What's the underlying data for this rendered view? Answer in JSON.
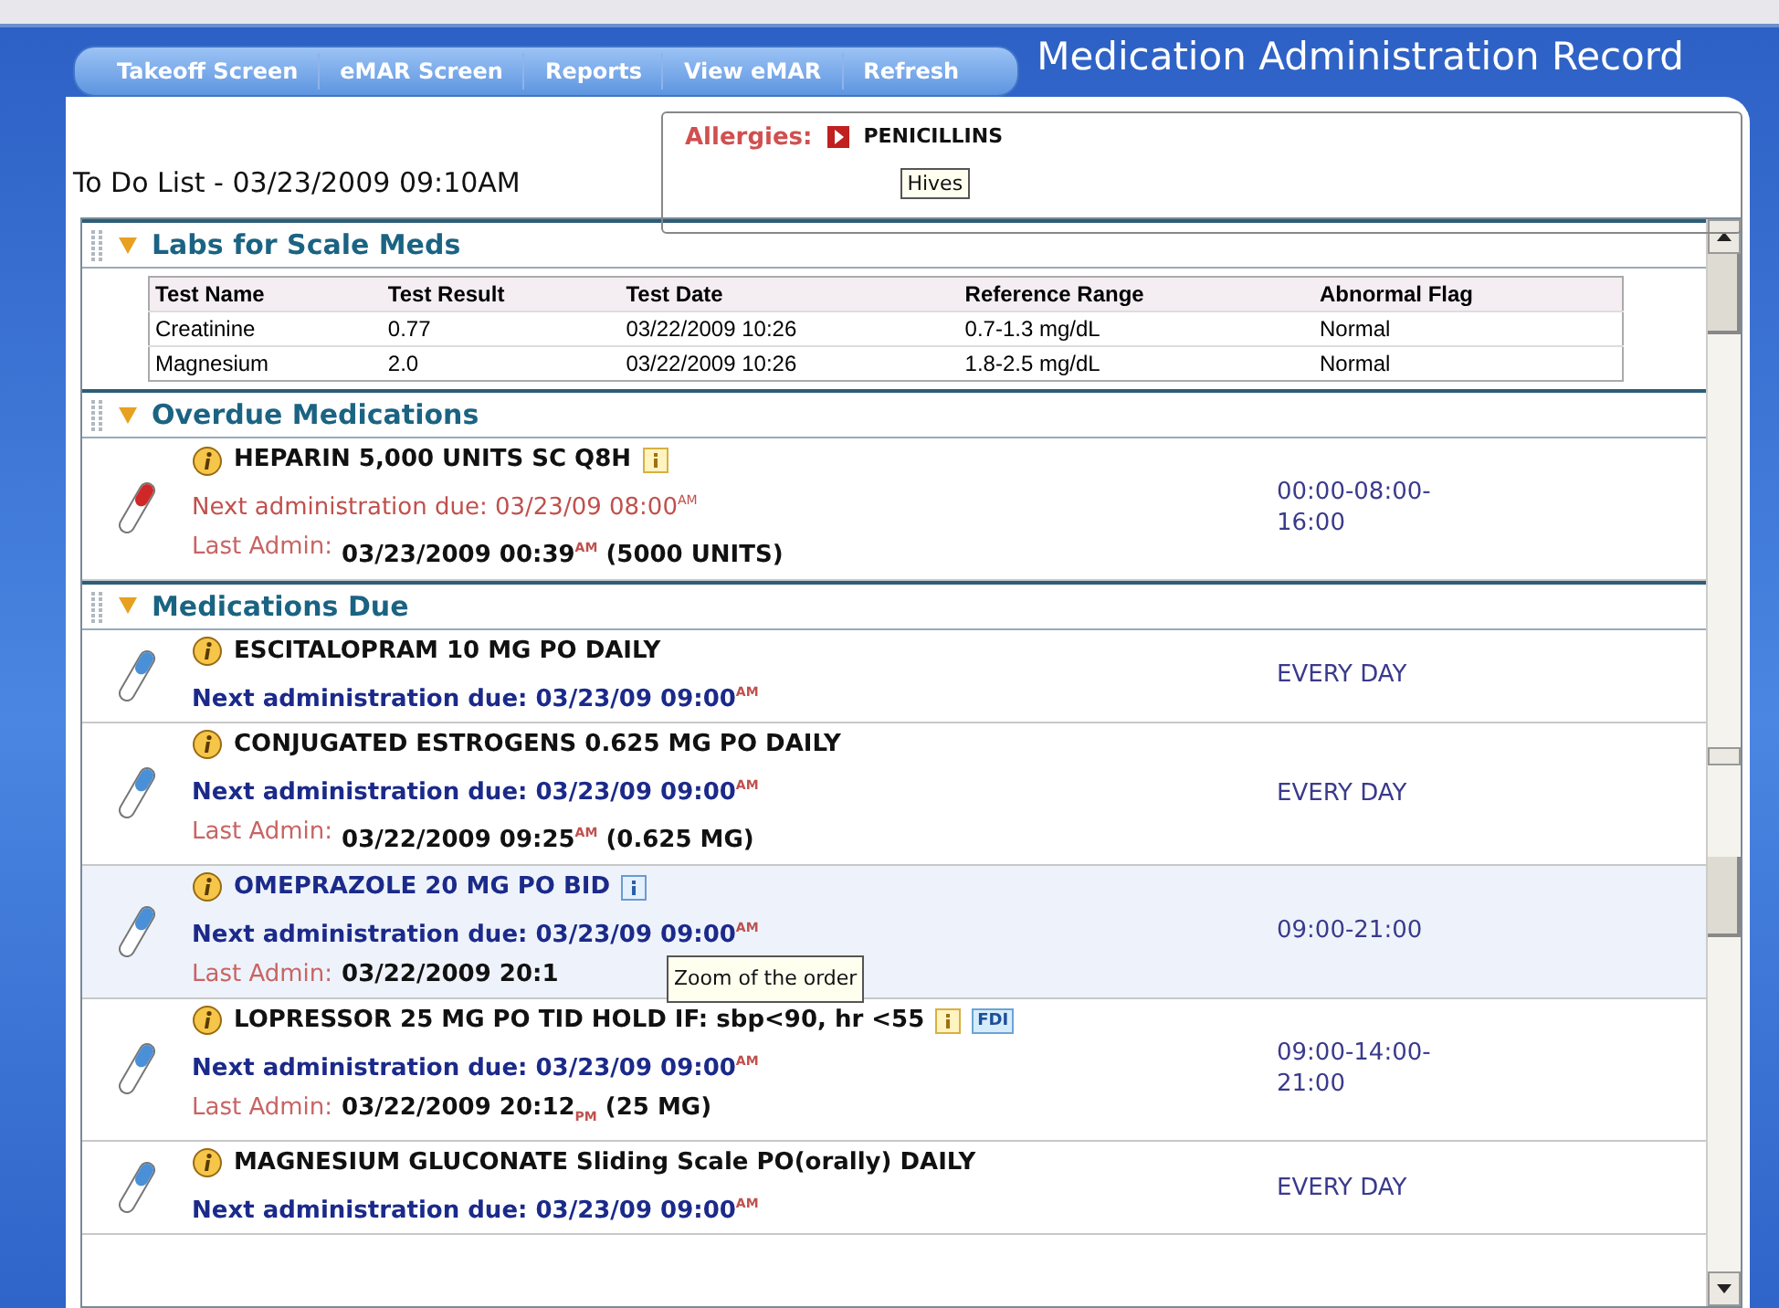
{
  "header": {
    "title": "Medication Administration Record",
    "tabs": [
      {
        "label": "Takeoff Screen"
      },
      {
        "label": "eMAR Screen"
      },
      {
        "label": "Reports"
      },
      {
        "label": "View eMAR"
      },
      {
        "label": "Refresh"
      }
    ]
  },
  "todo_title": "To Do List - 03/23/2009 09:10AM",
  "allergies": {
    "label": "Allergies:",
    "items": [
      {
        "name": "PENICILLINS",
        "tooltip": "Hives"
      }
    ]
  },
  "sections": [
    {
      "kind": "labs",
      "title": "Labs for Scale Meds",
      "expanded": true,
      "table": {
        "columns": [
          "Test Name",
          "Test Result",
          "Test Date",
          "Reference Range",
          "Abnormal Flag"
        ],
        "rows": [
          [
            "Creatinine",
            "0.77",
            "03/22/2009 10:26",
            "0.7-1.3 mg/dL",
            "Normal"
          ],
          [
            "Magnesium",
            "2.0",
            "03/22/2009 10:26",
            "1.8-2.5 mg/dL",
            "Normal"
          ]
        ]
      }
    },
    {
      "kind": "meds",
      "title": "Overdue Medications",
      "expanded": true,
      "items": [
        {
          "name": "HEPARIN 5,000 UNITS SC Q8H",
          "overdue": true,
          "highlighted": false,
          "badges": [
            {
              "kind": "info"
            }
          ],
          "next_due": "Next administration due: 03/23/09 08:00$^{AM}$",
          "last_admin_label": "Last Admin:",
          "last_admin": "03/23/2009 00:39$^{AM}$ (5000 UNITS)",
          "schedule": "00:00-08:00-16:00"
        }
      ]
    },
    {
      "kind": "meds",
      "title": "Medications Due",
      "expanded": true,
      "items": [
        {
          "name": "ESCITALOPRAM 10 MG PO DAILY",
          "overdue": false,
          "highlighted": false,
          "next_due": "Next administration due: 03/23/09 09:00$^{AM}$",
          "schedule": "EVERY DAY"
        },
        {
          "name": "CONJUGATED ESTROGENS 0.625 MG PO DAILY",
          "overdue": false,
          "highlighted": false,
          "next_due": "Next administration due: 03/23/09 09:00$^{AM}$",
          "last_admin_label": "Last Admin:",
          "last_admin": "03/22/2009 09:25$^{AM}$ (0.625 MG)",
          "schedule": "EVERY DAY"
        },
        {
          "name": "OMEPRAZOLE 20 MG PO BID",
          "overdue": false,
          "highlighted": true,
          "badges": [
            {
              "kind": "info"
            }
          ],
          "next_due": "Next administration due: 03/23/09 09:00$^{AM}$",
          "last_admin_label": "Last Admin:",
          "last_admin": "03/22/2009 20:1",
          "schedule": "09:00-21:00",
          "tooltip": "Zoom of the order"
        },
        {
          "name": "LOPRESSOR 25 MG PO TID HOLD IF: sbp<90, hr <55",
          "overdue": false,
          "highlighted": false,
          "badges": [
            {
              "kind": "info"
            },
            {
              "kind": "label",
              "text": "FDI"
            }
          ],
          "next_due": "Next administration due: 03/23/09 09:00$^{AM}$",
          "last_admin_label": "Last Admin:",
          "last_admin": "03/22/2009 20:12$_{PM}$ (25 MG)",
          "schedule": "09:00-14:00-21:00"
        },
        {
          "name": "MAGNESIUM GLUCONATE Sliding Scale PO(orally) DAILY",
          "overdue": false,
          "highlighted": false,
          "next_due": "Next administration due: 03/23/09 09:00$^{AM}$",
          "schedule": "EVERY DAY"
        }
      ]
    }
  ]
}
